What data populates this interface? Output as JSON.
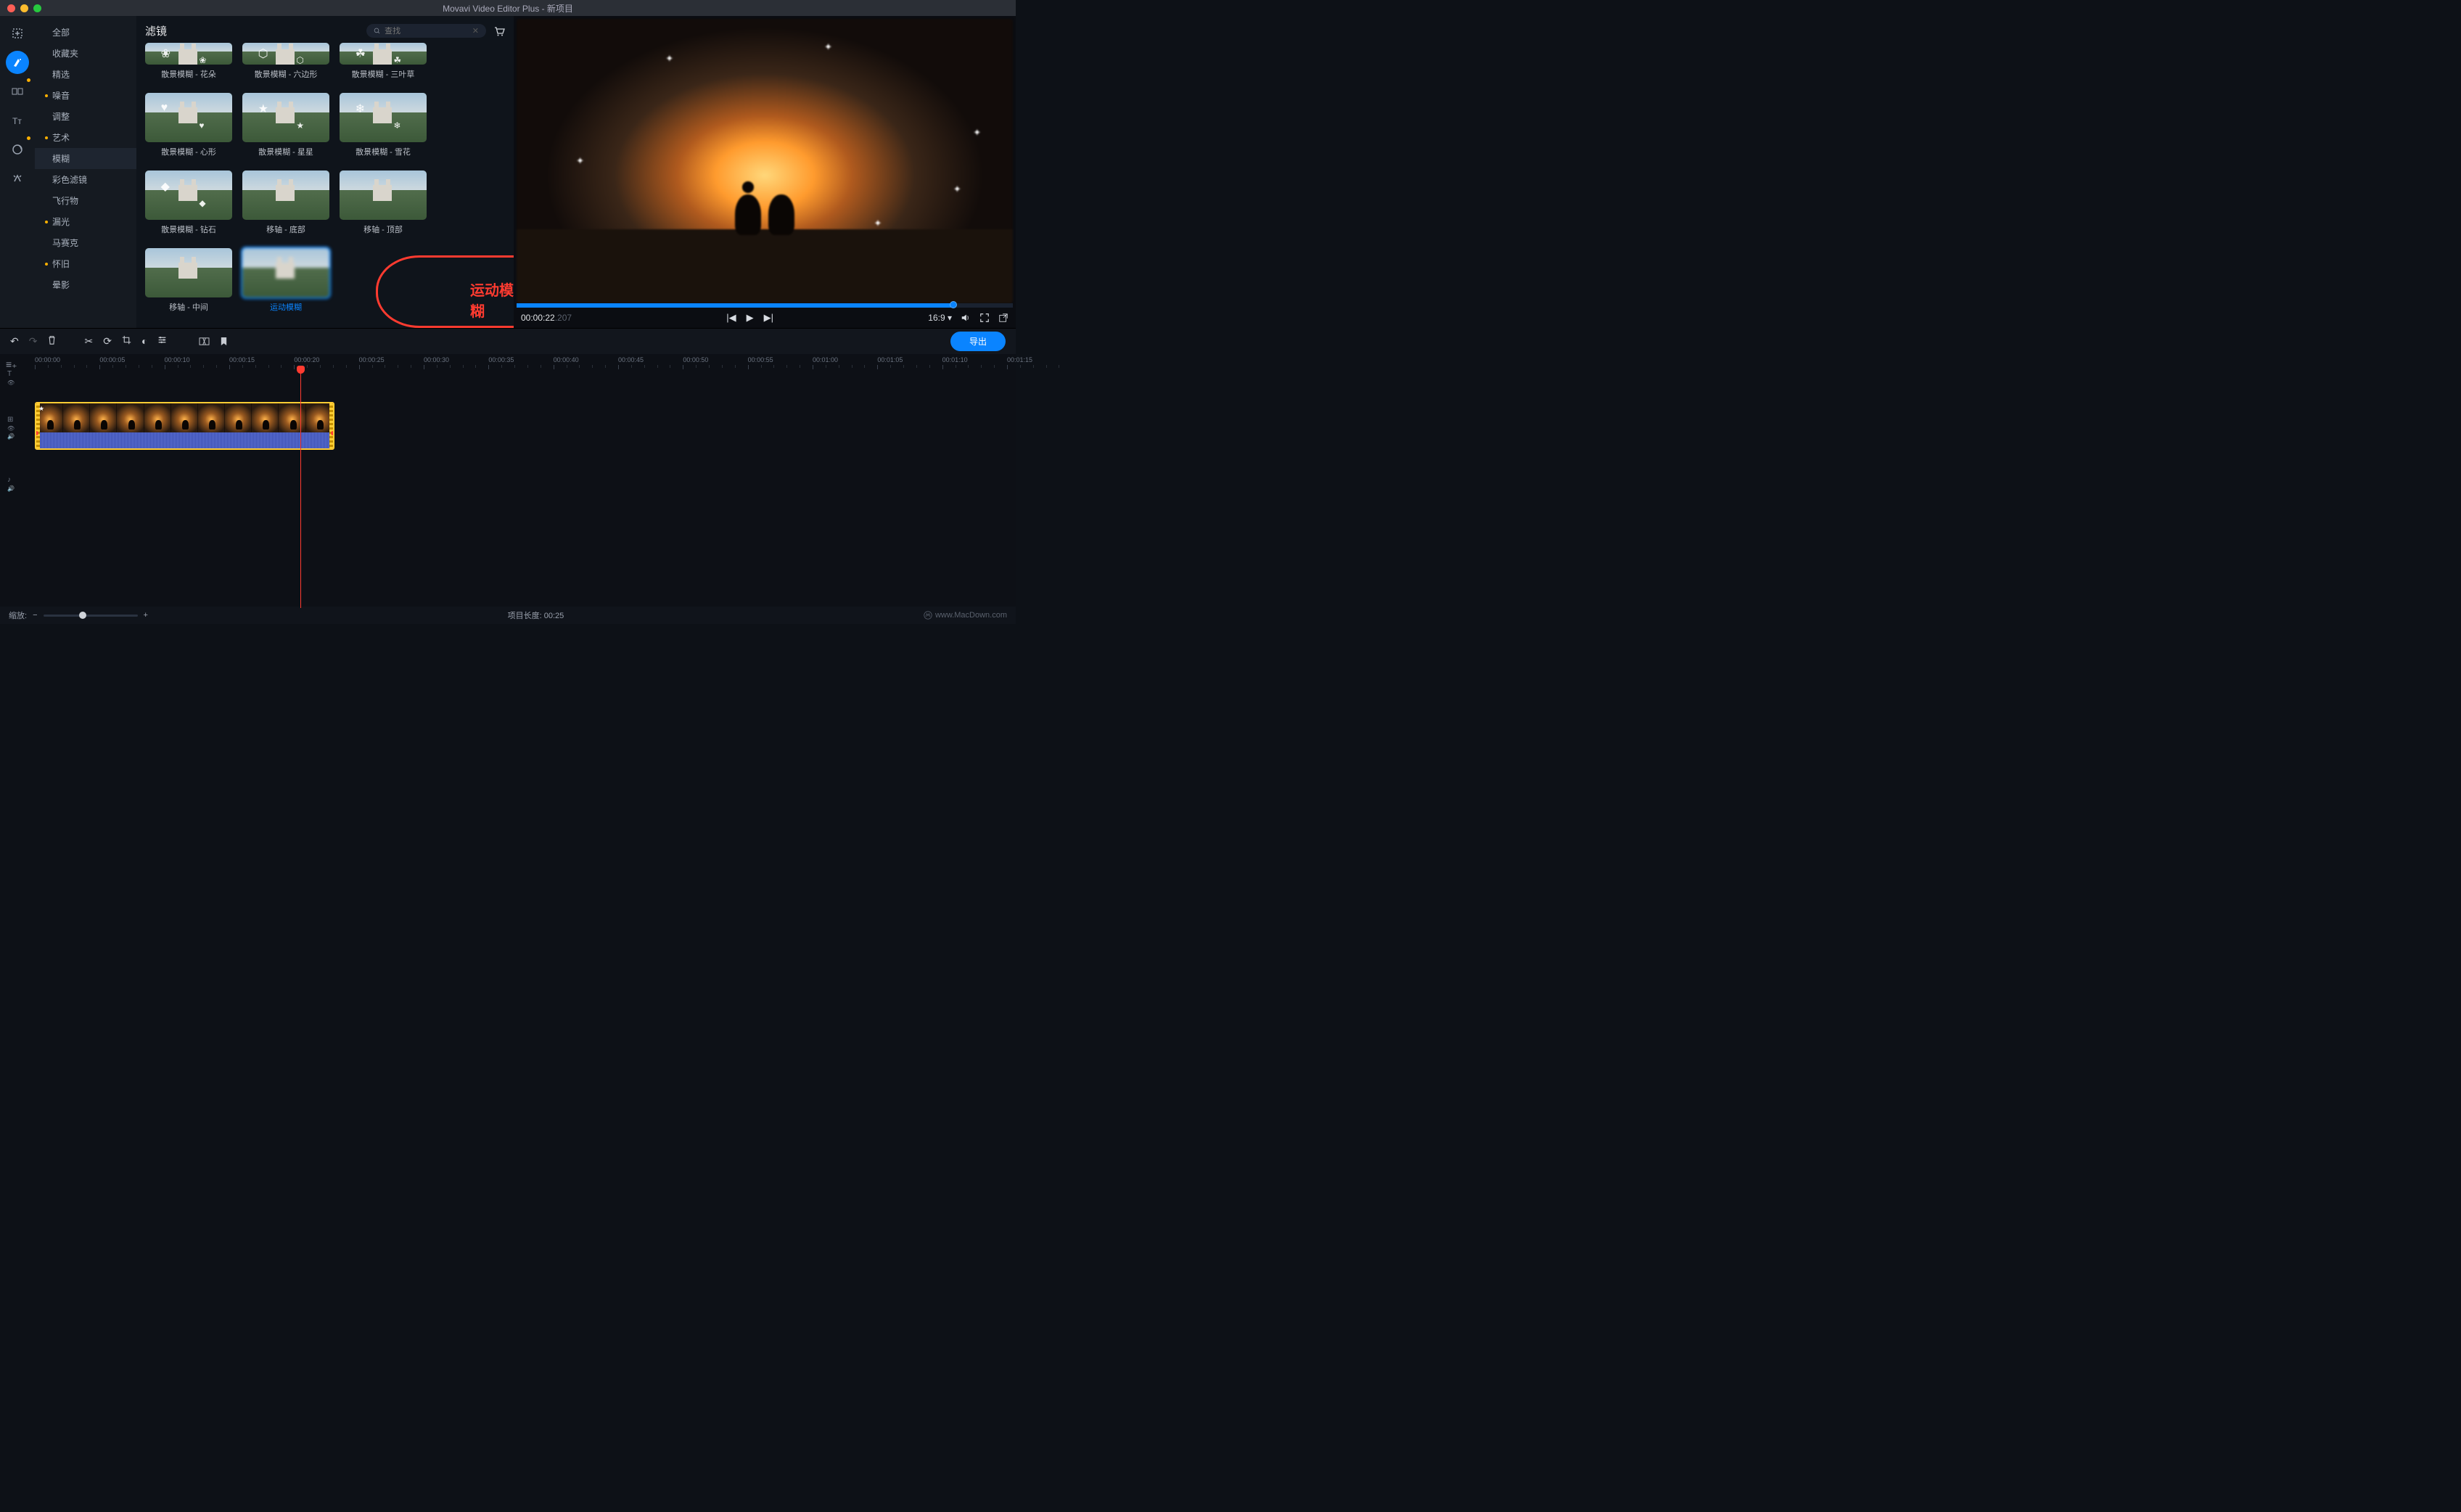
{
  "window": {
    "title": "Movavi Video Editor Plus - 新项目"
  },
  "sidebar_tools": [
    {
      "name": "import",
      "dot": false
    },
    {
      "name": "filters",
      "dot": false,
      "active": true
    },
    {
      "name": "transitions",
      "dot": true
    },
    {
      "name": "titles",
      "dot": false
    },
    {
      "name": "stickers",
      "dot": true
    },
    {
      "name": "more",
      "dot": false
    }
  ],
  "category": {
    "items": [
      {
        "label": "全部",
        "dot": false
      },
      {
        "label": "收藏夹",
        "dot": false
      },
      {
        "label": "精选",
        "dot": false
      },
      {
        "label": "噪音",
        "dot": true
      },
      {
        "label": "调整",
        "dot": false
      },
      {
        "label": "艺术",
        "dot": true
      },
      {
        "label": "模糊",
        "dot": false,
        "selected": true
      },
      {
        "label": "彩色滤镜",
        "dot": false
      },
      {
        "label": "飞行物",
        "dot": false
      },
      {
        "label": "漏光",
        "dot": true
      },
      {
        "label": "马赛克",
        "dot": false
      },
      {
        "label": "怀旧",
        "dot": true
      },
      {
        "label": "晕影",
        "dot": false
      }
    ]
  },
  "browser": {
    "title": "滤镜",
    "search_placeholder": "查找",
    "rows": [
      [
        {
          "label": "散景模糊 - 花朵",
          "short": true
        },
        {
          "label": "散景模糊 - 六边形",
          "short": true
        },
        {
          "label": "散景模糊 - 三叶草",
          "short": true
        }
      ],
      [
        {
          "label": "散景模糊 - 心形"
        },
        {
          "label": "散景模糊 - 星星"
        },
        {
          "label": "散景模糊 - 雪花"
        }
      ],
      [
        {
          "label": "散景模糊 - 钻石"
        },
        {
          "label": "移轴 - 底部"
        },
        {
          "label": "移轴 - 顶部"
        }
      ],
      [
        {
          "label": "移轴 - 中间"
        },
        {
          "label": "运动模糊",
          "selected": true
        }
      ]
    ],
    "annotation_text": "运动模糊"
  },
  "preview": {
    "time_main": "00:00:22",
    "time_ms": ".207",
    "aspect": "16:9",
    "progress_pct": 88
  },
  "toolbar": {
    "export_label": "导出"
  },
  "timeline": {
    "ticks": [
      "00:00:00",
      "00:00:05",
      "00:00:10",
      "00:00:15",
      "00:00:20",
      "00:00:25",
      "00:00:30",
      "00:00:35",
      "00:00:40",
      "00:00:45",
      "00:00:50",
      "00:00:55",
      "00:01:00",
      "00:01:05",
      "00:01:10",
      "00:01:15"
    ],
    "playhead_pct": 27.3,
    "clip_width_pct": 30.8
  },
  "footer": {
    "zoom_label": "缩放:",
    "zoom_pos_pct": 42,
    "duration_label": "项目长度:  00:25",
    "brand": "www.MacDown.com"
  }
}
